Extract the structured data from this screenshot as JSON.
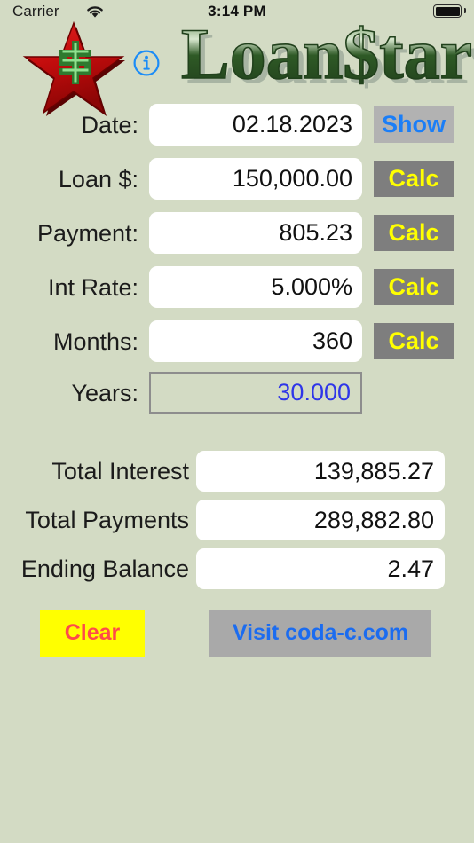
{
  "status_bar": {
    "carrier": "Carrier",
    "wifi_icon": "wifi-icon",
    "time": "3:14 PM",
    "battery_icon": "battery-full-icon"
  },
  "header": {
    "star_logo": "loanstar-star-logo",
    "info_icon": "info-circle-icon",
    "wordmark": "LoanStar",
    "wordmark_parts": [
      "Loan",
      "$",
      "tar"
    ]
  },
  "form": {
    "rows": [
      {
        "label": "Date:",
        "value": "02.18.2023",
        "button": "Show",
        "button_kind": "show"
      },
      {
        "label": "Loan $:",
        "value": "150,000.00",
        "button": "Calc",
        "button_kind": "calc"
      },
      {
        "label": "Payment:",
        "value": "805.23",
        "button": "Calc",
        "button_kind": "calc"
      },
      {
        "label": "Int Rate:",
        "value": "5.000%",
        "button": "Calc",
        "button_kind": "calc"
      },
      {
        "label": "Months:",
        "value": "360",
        "button": "Calc",
        "button_kind": "calc"
      }
    ],
    "years": {
      "label": "Years:",
      "value": "30.000"
    }
  },
  "totals": {
    "rows": [
      {
        "label": "Total Interest",
        "value": "139,885.27"
      },
      {
        "label": "Total Payments",
        "value": "289,882.80"
      },
      {
        "label": "Ending Balance",
        "value": "2.47"
      }
    ]
  },
  "actions": {
    "clear_label": "Clear",
    "visit_label": "Visit coda-c.com"
  },
  "colors": {
    "background": "#d3dbc4",
    "field_white": "#ffffff",
    "show_button_bg": "#b2b2b2",
    "show_button_text": "#1b7ef7",
    "calc_button_bg": "#7e7e7e",
    "calc_button_text": "#ffff00",
    "years_text": "#2f36e8",
    "clear_bg": "#ffff00",
    "clear_text": "#ff4a4a",
    "visit_bg": "#a9a9a9",
    "visit_text": "#1b6cf0",
    "logo_green": "#3f6b35",
    "logo_star_red": "#cc1111"
  }
}
